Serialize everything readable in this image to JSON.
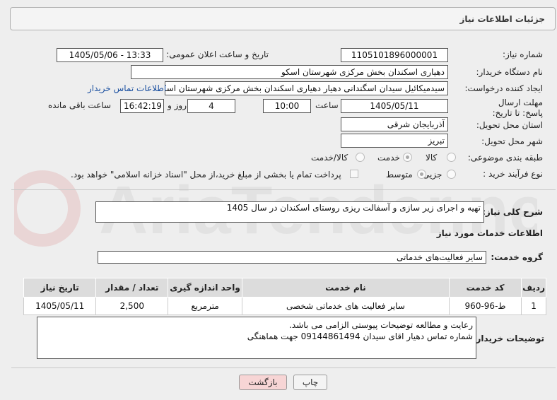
{
  "header": {
    "title": "جزئیات اطلاعات نیاز"
  },
  "labels": {
    "need_number": "شماره نیاز:",
    "announce_datetime": "تاریخ و ساعت اعلان عمومی:",
    "buyer_org": "نام دستگاه خریدار:",
    "requester": "ایجاد کننده درخواست:",
    "buyer_contact_link": "اطلاعات تماس خریدار",
    "deadline": "مهلت ارسال پاسخ: تا تاریخ:",
    "time_word": "ساعت",
    "days_and": "روز و",
    "remaining": "ساعت باقی مانده",
    "province": "استان محل تحویل:",
    "city": "شهر محل تحویل:",
    "category": "طبقه بندی موضوعی:",
    "process_type": "نوع فرآیند خرید :",
    "description": "شرح کلی نیاز:",
    "services_info": "اطلاعات خدمات مورد نیاز",
    "service_group": "گروه خدمت:",
    "buyer_notes": "توضیحات خریدار:"
  },
  "values": {
    "need_number": "1105101896000001",
    "announce_datetime": "1405/05/06 - 13:33",
    "buyer_org": "دهیاری اسکندان بخش مرکزی شهرستان اسکو",
    "requester": "سیدمیکائیل سیدان اسگندانی دهیار دهیاری اسکندان بخش مرکزی شهرستان اسکو",
    "deadline_date": "1405/05/11",
    "deadline_time": "10:00",
    "days": "4",
    "remaining_time": "16:42:19",
    "province": "آذربایجان شرقی",
    "city": "تبریز",
    "description": "تهیه و اجرای زیر سازی و آسفالت ریزی روستای اسکندان در سال 1405",
    "service_group": "سایر فعالیت‌های خدماتی",
    "buyer_notes_line1": "رعایت و مطالعه توضیحات پیوستی الزامی می باشد.",
    "buyer_notes_line2": "شماره تماس دهیار اقای سیدان 09144861494 جهت هماهنگی"
  },
  "category_options": [
    {
      "label": "کالا",
      "selected": false
    },
    {
      "label": "خدمت",
      "selected": true
    },
    {
      "label": "کالا/خدمت",
      "selected": false
    }
  ],
  "process_options": [
    {
      "label": "جزیی",
      "selected": false
    },
    {
      "label": "متوسط",
      "selected": true
    }
  ],
  "payment_note": "پرداخت تمام یا بخشی از مبلغ خرید،از محل \"اسناد خزانه اسلامی\" خواهد بود.",
  "table": {
    "headers": [
      "ردیف",
      "کد خدمت",
      "نام خدمت",
      "واحد اندازه گیری",
      "تعداد / مقدار",
      "تاریخ نیاز"
    ],
    "rows": [
      [
        "1",
        "ط-96-960",
        "سایر فعالیت های خدماتی شخصی",
        "مترمربع",
        "2,500",
        "1405/05/11"
      ]
    ]
  },
  "buttons": {
    "print": "چاپ",
    "back": "بازگشت"
  },
  "watermark": "AriaTender.neT",
  "colors": {
    "back_button_bg": "#f7d5d5",
    "print_button_bg": "#f4f4f4",
    "link": "#1a4fa0"
  }
}
